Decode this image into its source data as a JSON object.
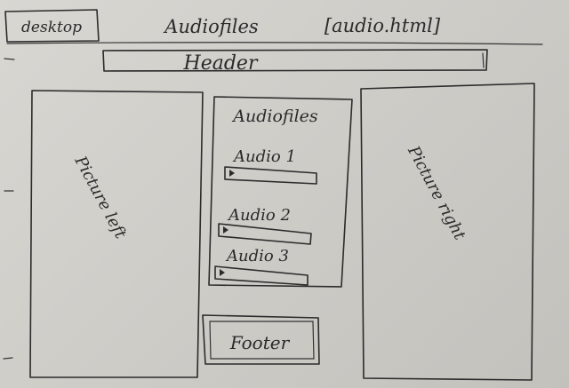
{
  "top_bar": {
    "device_label": "desktop",
    "title": "Audiofiles",
    "file_label": "[audio.html]"
  },
  "header": {
    "label": "Header"
  },
  "left_panel": {
    "label": "Picture left"
  },
  "right_panel": {
    "label": "Picture right"
  },
  "audio_section": {
    "heading": "Audiofiles",
    "items": [
      {
        "label": "Audio 1"
      },
      {
        "label": "Audio 2"
      },
      {
        "label": "Audio 3"
      }
    ]
  },
  "footer": {
    "label": "Footer"
  },
  "colors": {
    "ink": "#2b2b2b",
    "paper": "#d2d0cb"
  }
}
